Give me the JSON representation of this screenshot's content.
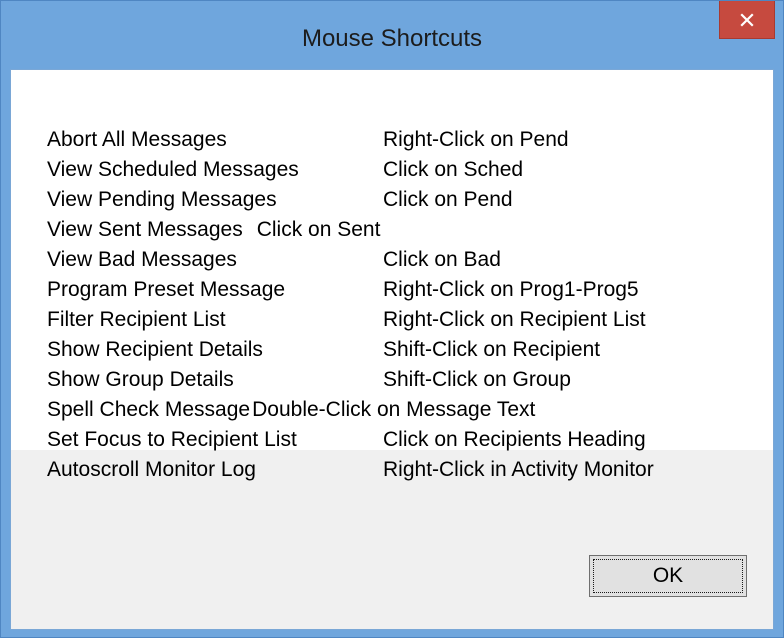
{
  "window": {
    "title": "Mouse Shortcuts",
    "close_icon": "close-icon",
    "close_glyph": "✕"
  },
  "shortcuts": [
    {
      "action": "Abort All Messages",
      "shortcut": "Right-Click on Pend"
    },
    {
      "action": "View Scheduled Messages",
      "shortcut": "Click on Sched"
    },
    {
      "action": "View Pending Messages",
      "shortcut": "Click on Pend"
    },
    {
      "action": "View Sent Messages",
      "shortcut": "Click on Sent"
    },
    {
      "action": "View Bad Messages",
      "shortcut": "Click on Bad"
    },
    {
      "action": "Program Preset Message",
      "shortcut": "Right-Click on Prog1-Prog5"
    },
    {
      "action": "Filter Recipient List",
      "shortcut": "Right-Click on Recipient List"
    },
    {
      "action": "Show Recipient Details",
      "shortcut": "Shift-Click on Recipient"
    },
    {
      "action": "Show Group Details",
      "shortcut": "Shift-Click on Group"
    },
    {
      "action": "Spell Check Message",
      "shortcut": "Double-Click on Message Text"
    },
    {
      "action": "Set Focus to Recipient List",
      "shortcut": "Click on Recipients Heading"
    },
    {
      "action": "Autoscroll Monitor Log",
      "shortcut": "Right-Click in Activity Monitor"
    }
  ],
  "footer": {
    "ok_label": "OK"
  },
  "colors": {
    "title_bar": "#6fa6dd",
    "close_button": "#c64a3f",
    "content_bg": "#ffffff",
    "footer_bg": "#f0f0f0"
  }
}
